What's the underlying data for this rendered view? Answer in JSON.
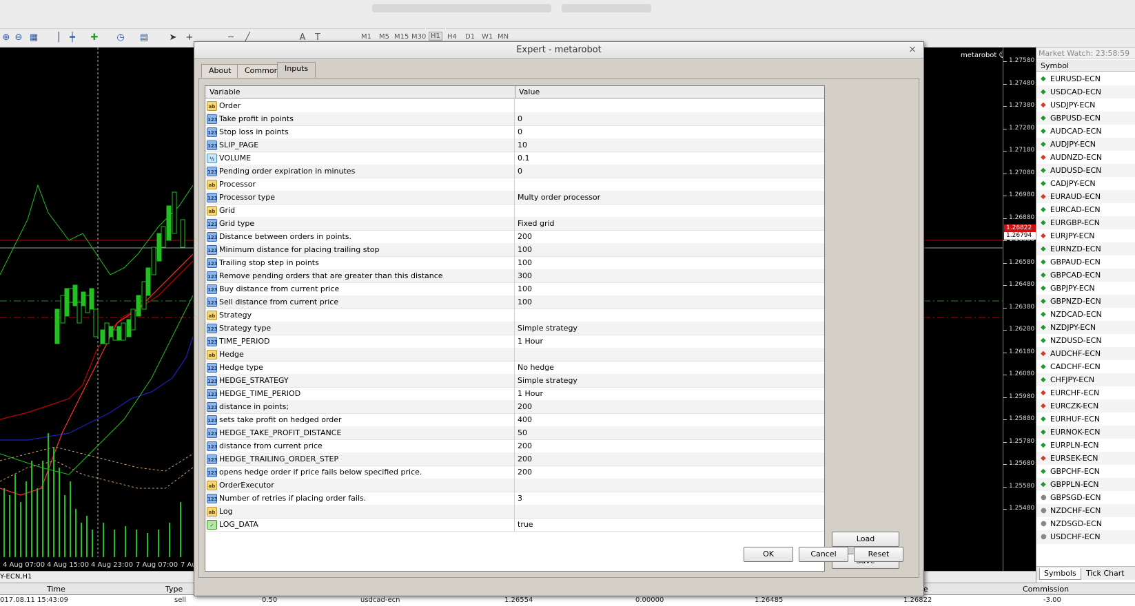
{
  "toolbar": {
    "timeframes": [
      "M1",
      "M5",
      "M15",
      "M30",
      "H1",
      "H4",
      "D1",
      "W1",
      "MN"
    ],
    "active_timeframe": "H1"
  },
  "chart": {
    "name": "metarobot",
    "prices": [
      "1.27580",
      "1.27480",
      "1.27380",
      "1.27280",
      "1.27180",
      "1.27080",
      "1.26980",
      "1.26880",
      "1.26680",
      "1.26580",
      "1.26480",
      "1.26380",
      "1.26280",
      "1.26180",
      "1.26080",
      "1.25980",
      "1.25880",
      "1.25780",
      "1.25680",
      "1.25580",
      "1.25480"
    ],
    "price_flag_red": "1.26822",
    "price_flag_white": "1.26794",
    "times": [
      "4 Aug 07:00",
      "4 Aug 15:00",
      "4 Aug 23:00",
      "7 Aug 07:00",
      "7 Au"
    ],
    "tab_label": "Y-ECN,H1"
  },
  "terminal": {
    "headers": {
      "time": "Time",
      "type": "Type",
      "e": "e",
      "commission": "Commission"
    },
    "row": {
      "time": "017.08.11 15:43:09",
      "type": "sell",
      "volume": "0.50",
      "symbol": "usdcad-ecn",
      "price": "1.26554",
      "sl": "0.00000",
      "tp": "1.26485",
      "cur": "1.26822",
      "commission": "-3.00"
    }
  },
  "market_watch": {
    "title": "Market Watch: 23:58:59",
    "header": "Symbol",
    "symbols": [
      {
        "name": "EURUSD-ECN",
        "dir": "up"
      },
      {
        "name": "USDCAD-ECN",
        "dir": "up"
      },
      {
        "name": "USDJPY-ECN",
        "dir": "down"
      },
      {
        "name": "GBPUSD-ECN",
        "dir": "up"
      },
      {
        "name": "AUDCAD-ECN",
        "dir": "up"
      },
      {
        "name": "AUDJPY-ECN",
        "dir": "up"
      },
      {
        "name": "AUDNZD-ECN",
        "dir": "down"
      },
      {
        "name": "AUDUSD-ECN",
        "dir": "up"
      },
      {
        "name": "CADJPY-ECN",
        "dir": "up"
      },
      {
        "name": "EURAUD-ECN",
        "dir": "down"
      },
      {
        "name": "EURCAD-ECN",
        "dir": "up"
      },
      {
        "name": "EURGBP-ECN",
        "dir": "up"
      },
      {
        "name": "EURJPY-ECN",
        "dir": "down"
      },
      {
        "name": "EURNZD-ECN",
        "dir": "up"
      },
      {
        "name": "GBPAUD-ECN",
        "dir": "up"
      },
      {
        "name": "GBPCAD-ECN",
        "dir": "up"
      },
      {
        "name": "GBPJPY-ECN",
        "dir": "up"
      },
      {
        "name": "GBPNZD-ECN",
        "dir": "up"
      },
      {
        "name": "NZDCAD-ECN",
        "dir": "up"
      },
      {
        "name": "NZDJPY-ECN",
        "dir": "up"
      },
      {
        "name": "NZDUSD-ECN",
        "dir": "up"
      },
      {
        "name": "AUDCHF-ECN",
        "dir": "down"
      },
      {
        "name": "CADCHF-ECN",
        "dir": "up"
      },
      {
        "name": "CHFJPY-ECN",
        "dir": "up"
      },
      {
        "name": "EURCHF-ECN",
        "dir": "down"
      },
      {
        "name": "EURCZK-ECN",
        "dir": "down"
      },
      {
        "name": "EURHUF-ECN",
        "dir": "up"
      },
      {
        "name": "EURNOK-ECN",
        "dir": "up"
      },
      {
        "name": "EURPLN-ECN",
        "dir": "up"
      },
      {
        "name": "EURSEK-ECN",
        "dir": "down"
      },
      {
        "name": "GBPCHF-ECN",
        "dir": "up"
      },
      {
        "name": "GBPPLN-ECN",
        "dir": "up"
      },
      {
        "name": "GBPSGD-ECN",
        "dir": "flat"
      },
      {
        "name": "NZDCHF-ECN",
        "dir": "flat"
      },
      {
        "name": "NZDSGD-ECN",
        "dir": "flat"
      },
      {
        "name": "USDCHF-ECN",
        "dir": "flat"
      }
    ],
    "tabs": [
      "Symbols",
      "Tick Chart"
    ]
  },
  "dialog": {
    "title": "Expert - metarobot",
    "tabs": [
      "About",
      "Common",
      "Inputs"
    ],
    "active_tab": "Inputs",
    "columns": {
      "variable": "Variable",
      "value": "Value"
    },
    "rows": [
      {
        "icon": "ab",
        "variable": "Order",
        "value": ""
      },
      {
        "icon": "num",
        "variable": "Take profit in points",
        "value": "0"
      },
      {
        "icon": "num",
        "variable": "Stop loss in points",
        "value": "0"
      },
      {
        "icon": "num",
        "variable": "SLIP_PAGE",
        "value": "10"
      },
      {
        "icon": "frac",
        "variable": "VOLUME",
        "value": "0.1"
      },
      {
        "icon": "num",
        "variable": "Pending order expiration in minutes",
        "value": "0"
      },
      {
        "icon": "ab",
        "variable": "Processor",
        "value": ""
      },
      {
        "icon": "num",
        "variable": "Processor type",
        "value": "Multy order processor"
      },
      {
        "icon": "ab",
        "variable": "Grid",
        "value": ""
      },
      {
        "icon": "num",
        "variable": "Grid type",
        "value": "Fixed grid"
      },
      {
        "icon": "num",
        "variable": "Distance between orders in points.",
        "value": "200"
      },
      {
        "icon": "num",
        "variable": "Minimum distance for placing trailing stop",
        "value": "100"
      },
      {
        "icon": "num",
        "variable": "Trailing stop step in points",
        "value": "100"
      },
      {
        "icon": "num",
        "variable": "Remove pending orders that are greater than this distance",
        "value": "300"
      },
      {
        "icon": "num",
        "variable": "Buy distance from current price",
        "value": "100"
      },
      {
        "icon": "num",
        "variable": "Sell distance from current price",
        "value": "100"
      },
      {
        "icon": "ab",
        "variable": "Strategy",
        "value": ""
      },
      {
        "icon": "num",
        "variable": "Strategy type",
        "value": "Simple  strategy"
      },
      {
        "icon": "num",
        "variable": "TIME_PERIOD",
        "value": "1 Hour"
      },
      {
        "icon": "ab",
        "variable": "Hedge",
        "value": ""
      },
      {
        "icon": "num",
        "variable": "Hedge type",
        "value": "No hedge"
      },
      {
        "icon": "num",
        "variable": "HEDGE_STRATEGY",
        "value": "Simple  strategy"
      },
      {
        "icon": "num",
        "variable": "HEDGE_TIME_PERIOD",
        "value": "1 Hour"
      },
      {
        "icon": "num",
        "variable": "distance in points;",
        "value": "200"
      },
      {
        "icon": "num",
        "variable": "sets take profit on hedged order",
        "value": "400"
      },
      {
        "icon": "num",
        "variable": "HEDGE_TAKE_PROFIT_DISTANCE",
        "value": "50"
      },
      {
        "icon": "num",
        "variable": "distance from current price",
        "value": "200"
      },
      {
        "icon": "num",
        "variable": "HEDGE_TRAILING_ORDER_STEP",
        "value": "200"
      },
      {
        "icon": "num",
        "variable": "opens hedge order if price fails below specified price.",
        "value": "200"
      },
      {
        "icon": "ab",
        "variable": "OrderExecutor",
        "value": ""
      },
      {
        "icon": "num",
        "variable": "Number of retries if placing order fails.",
        "value": "3"
      },
      {
        "icon": "ab",
        "variable": "Log",
        "value": ""
      },
      {
        "icon": "bool",
        "variable": "LOG_DATA",
        "value": "true"
      }
    ],
    "load_label": "Load",
    "save_label": "Save",
    "ok_label": "OK",
    "cancel_label": "Cancel",
    "reset_label": "Reset"
  }
}
